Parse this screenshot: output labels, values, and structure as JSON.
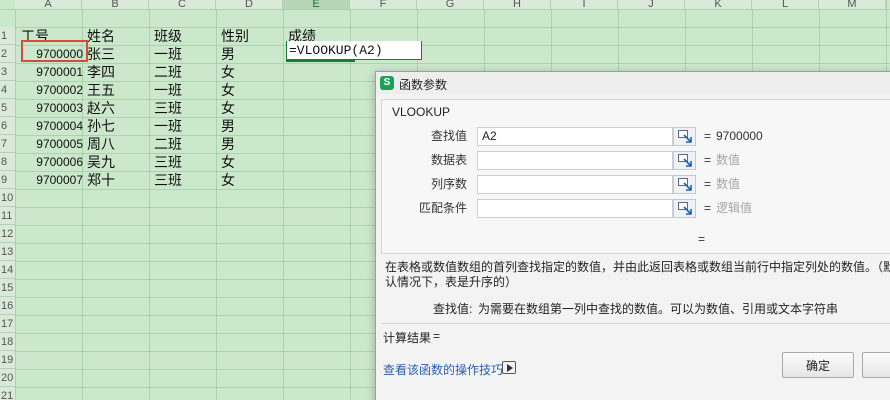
{
  "sheet": {
    "columns": [
      "A",
      "B",
      "C",
      "D",
      "E",
      "F",
      "G",
      "H",
      "I",
      "J",
      "K",
      "L",
      "M"
    ],
    "active_column": "E",
    "rows": [
      "1",
      "2",
      "3",
      "4",
      "5",
      "6",
      "7",
      "8",
      "9",
      "10",
      "11",
      "12",
      "13",
      "14",
      "15",
      "16",
      "17",
      "18",
      "19",
      "20",
      "21"
    ],
    "headers": {
      "id": "工号",
      "name": "姓名",
      "class": "班级",
      "gender": "性别",
      "score": "成绩"
    },
    "records": [
      {
        "id": "9700000",
        "name": "张三",
        "class": "一班",
        "gender": "男"
      },
      {
        "id": "9700001",
        "name": "李四",
        "class": "二班",
        "gender": "女"
      },
      {
        "id": "9700002",
        "name": "王五",
        "class": "一班",
        "gender": "女"
      },
      {
        "id": "9700003",
        "name": "赵六",
        "class": "三班",
        "gender": "女"
      },
      {
        "id": "9700004",
        "name": "孙七",
        "class": "一班",
        "gender": "男"
      },
      {
        "id": "9700005",
        "name": "周八",
        "class": "二班",
        "gender": "男"
      },
      {
        "id": "9700006",
        "name": "吴九",
        "class": "三班",
        "gender": "女"
      },
      {
        "id": "9700007",
        "name": "郑十",
        "class": "三班",
        "gender": "女"
      }
    ],
    "editing_cell_formula": "=VLOOKUP(A2)",
    "accent_color": "#1c7a3a",
    "selection_color": "#d94a3a"
  },
  "dialog": {
    "title": "函数参数",
    "app_icon_letter": "S",
    "function_name": "VLOOKUP",
    "args": [
      {
        "label": "查找值",
        "value": "A2",
        "eq": "=",
        "result": "9700000",
        "is_hint": false
      },
      {
        "label": "数据表",
        "value": "",
        "eq": "=",
        "result": "数值",
        "is_hint": true
      },
      {
        "label": "列序数",
        "value": "",
        "eq": "=",
        "result": "数值",
        "is_hint": true
      },
      {
        "label": "匹配条件",
        "value": "",
        "eq": "=",
        "result": "逻辑值",
        "is_hint": true
      }
    ],
    "formula_result_eq": "=",
    "description": "在表格或数值数组的首列查找指定的数值，并由此返回表格或数组当前行中指定列处的数值。（默认情况下，表是升序的）",
    "param_desc_label": "查找值:",
    "param_desc_text": "为需要在数组第一列中查找的数值。可以为数值、引用或文本字符串",
    "result_label": "计算结果",
    "result_eq": "=",
    "help_link": "查看该函数的操作技巧",
    "ok_label": "确定"
  }
}
